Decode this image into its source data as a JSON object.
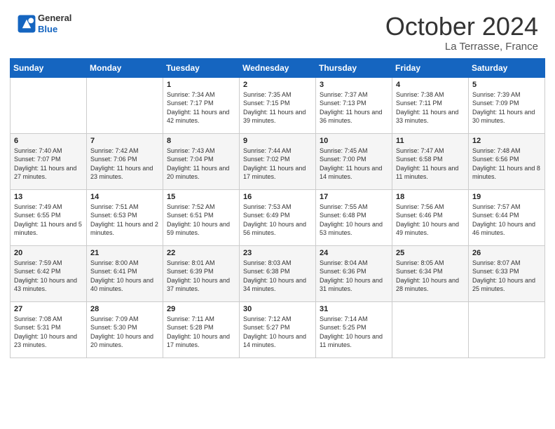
{
  "header": {
    "logo_line1": "General",
    "logo_line2": "Blue",
    "month": "October 2024",
    "location": "La Terrasse, France"
  },
  "weekdays": [
    "Sunday",
    "Monday",
    "Tuesday",
    "Wednesday",
    "Thursday",
    "Friday",
    "Saturday"
  ],
  "weeks": [
    [
      {
        "day": "",
        "sunrise": "",
        "sunset": "",
        "daylight": ""
      },
      {
        "day": "",
        "sunrise": "",
        "sunset": "",
        "daylight": ""
      },
      {
        "day": "1",
        "sunrise": "Sunrise: 7:34 AM",
        "sunset": "Sunset: 7:17 PM",
        "daylight": "Daylight: 11 hours and 42 minutes."
      },
      {
        "day": "2",
        "sunrise": "Sunrise: 7:35 AM",
        "sunset": "Sunset: 7:15 PM",
        "daylight": "Daylight: 11 hours and 39 minutes."
      },
      {
        "day": "3",
        "sunrise": "Sunrise: 7:37 AM",
        "sunset": "Sunset: 7:13 PM",
        "daylight": "Daylight: 11 hours and 36 minutes."
      },
      {
        "day": "4",
        "sunrise": "Sunrise: 7:38 AM",
        "sunset": "Sunset: 7:11 PM",
        "daylight": "Daylight: 11 hours and 33 minutes."
      },
      {
        "day": "5",
        "sunrise": "Sunrise: 7:39 AM",
        "sunset": "Sunset: 7:09 PM",
        "daylight": "Daylight: 11 hours and 30 minutes."
      }
    ],
    [
      {
        "day": "6",
        "sunrise": "Sunrise: 7:40 AM",
        "sunset": "Sunset: 7:07 PM",
        "daylight": "Daylight: 11 hours and 27 minutes."
      },
      {
        "day": "7",
        "sunrise": "Sunrise: 7:42 AM",
        "sunset": "Sunset: 7:06 PM",
        "daylight": "Daylight: 11 hours and 23 minutes."
      },
      {
        "day": "8",
        "sunrise": "Sunrise: 7:43 AM",
        "sunset": "Sunset: 7:04 PM",
        "daylight": "Daylight: 11 hours and 20 minutes."
      },
      {
        "day": "9",
        "sunrise": "Sunrise: 7:44 AM",
        "sunset": "Sunset: 7:02 PM",
        "daylight": "Daylight: 11 hours and 17 minutes."
      },
      {
        "day": "10",
        "sunrise": "Sunrise: 7:45 AM",
        "sunset": "Sunset: 7:00 PM",
        "daylight": "Daylight: 11 hours and 14 minutes."
      },
      {
        "day": "11",
        "sunrise": "Sunrise: 7:47 AM",
        "sunset": "Sunset: 6:58 PM",
        "daylight": "Daylight: 11 hours and 11 minutes."
      },
      {
        "day": "12",
        "sunrise": "Sunrise: 7:48 AM",
        "sunset": "Sunset: 6:56 PM",
        "daylight": "Daylight: 11 hours and 8 minutes."
      }
    ],
    [
      {
        "day": "13",
        "sunrise": "Sunrise: 7:49 AM",
        "sunset": "Sunset: 6:55 PM",
        "daylight": "Daylight: 11 hours and 5 minutes."
      },
      {
        "day": "14",
        "sunrise": "Sunrise: 7:51 AM",
        "sunset": "Sunset: 6:53 PM",
        "daylight": "Daylight: 11 hours and 2 minutes."
      },
      {
        "day": "15",
        "sunrise": "Sunrise: 7:52 AM",
        "sunset": "Sunset: 6:51 PM",
        "daylight": "Daylight: 10 hours and 59 minutes."
      },
      {
        "day": "16",
        "sunrise": "Sunrise: 7:53 AM",
        "sunset": "Sunset: 6:49 PM",
        "daylight": "Daylight: 10 hours and 56 minutes."
      },
      {
        "day": "17",
        "sunrise": "Sunrise: 7:55 AM",
        "sunset": "Sunset: 6:48 PM",
        "daylight": "Daylight: 10 hours and 53 minutes."
      },
      {
        "day": "18",
        "sunrise": "Sunrise: 7:56 AM",
        "sunset": "Sunset: 6:46 PM",
        "daylight": "Daylight: 10 hours and 49 minutes."
      },
      {
        "day": "19",
        "sunrise": "Sunrise: 7:57 AM",
        "sunset": "Sunset: 6:44 PM",
        "daylight": "Daylight: 10 hours and 46 minutes."
      }
    ],
    [
      {
        "day": "20",
        "sunrise": "Sunrise: 7:59 AM",
        "sunset": "Sunset: 6:42 PM",
        "daylight": "Daylight: 10 hours and 43 minutes."
      },
      {
        "day": "21",
        "sunrise": "Sunrise: 8:00 AM",
        "sunset": "Sunset: 6:41 PM",
        "daylight": "Daylight: 10 hours and 40 minutes."
      },
      {
        "day": "22",
        "sunrise": "Sunrise: 8:01 AM",
        "sunset": "Sunset: 6:39 PM",
        "daylight": "Daylight: 10 hours and 37 minutes."
      },
      {
        "day": "23",
        "sunrise": "Sunrise: 8:03 AM",
        "sunset": "Sunset: 6:38 PM",
        "daylight": "Daylight: 10 hours and 34 minutes."
      },
      {
        "day": "24",
        "sunrise": "Sunrise: 8:04 AM",
        "sunset": "Sunset: 6:36 PM",
        "daylight": "Daylight: 10 hours and 31 minutes."
      },
      {
        "day": "25",
        "sunrise": "Sunrise: 8:05 AM",
        "sunset": "Sunset: 6:34 PM",
        "daylight": "Daylight: 10 hours and 28 minutes."
      },
      {
        "day": "26",
        "sunrise": "Sunrise: 8:07 AM",
        "sunset": "Sunset: 6:33 PM",
        "daylight": "Daylight: 10 hours and 25 minutes."
      }
    ],
    [
      {
        "day": "27",
        "sunrise": "Sunrise: 7:08 AM",
        "sunset": "Sunset: 5:31 PM",
        "daylight": "Daylight: 10 hours and 23 minutes."
      },
      {
        "day": "28",
        "sunrise": "Sunrise: 7:09 AM",
        "sunset": "Sunset: 5:30 PM",
        "daylight": "Daylight: 10 hours and 20 minutes."
      },
      {
        "day": "29",
        "sunrise": "Sunrise: 7:11 AM",
        "sunset": "Sunset: 5:28 PM",
        "daylight": "Daylight: 10 hours and 17 minutes."
      },
      {
        "day": "30",
        "sunrise": "Sunrise: 7:12 AM",
        "sunset": "Sunset: 5:27 PM",
        "daylight": "Daylight: 10 hours and 14 minutes."
      },
      {
        "day": "31",
        "sunrise": "Sunrise: 7:14 AM",
        "sunset": "Sunset: 5:25 PM",
        "daylight": "Daylight: 10 hours and 11 minutes."
      },
      {
        "day": "",
        "sunrise": "",
        "sunset": "",
        "daylight": ""
      },
      {
        "day": "",
        "sunrise": "",
        "sunset": "",
        "daylight": ""
      }
    ]
  ]
}
